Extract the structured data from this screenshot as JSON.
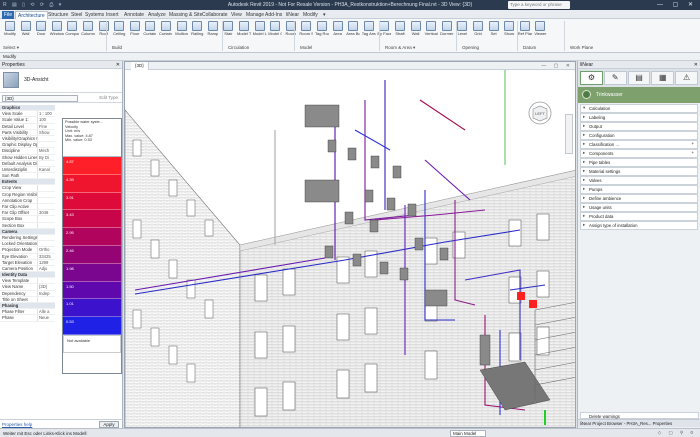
{
  "titlebar": {
    "title": "Autodesk Revit 2019 - Not For Resale Version - PH3A_Restkonstruktion+Berechnung Final.rvt - 3D View: {3D}",
    "search_placeholder": "Type a keyword or phrase",
    "quick_access": "R ▤ ▯ ⟲ ⟳ ⎙ ▾",
    "window_controls": "— ▢ ✕"
  },
  "tabs": [
    "File",
    "Architecture",
    "Structure",
    "Steel",
    "Systems",
    "Insert",
    "Annotate",
    "Analyze",
    "Massing & Site",
    "Collaborate",
    "View",
    "Manage",
    "Add-Ins",
    "liNear",
    "Modify",
    "▾"
  ],
  "active_tab": "Architecture",
  "ribbon": {
    "buttons": [
      "Modify",
      "Wall",
      "Door",
      "Window",
      "Component",
      "Column",
      "Roof",
      "Ceiling",
      "Floor",
      "Curtain System",
      "Curtain Grid",
      "Mullion",
      "Railing",
      "Ramp",
      "Stair",
      "Model Text",
      "Model Line",
      "Model Group",
      "Room",
      "Room Separator",
      "Tag Room",
      "Area",
      "Area Boundary",
      "Tag Area",
      "By Face",
      "Shaft",
      "Wall",
      "Vertical",
      "Dormer",
      "Level",
      "Grid",
      "Set",
      "Show",
      "Ref Plane",
      "Viewer"
    ],
    "panels": [
      "Select ▾",
      "Build",
      "Circulation",
      "Model",
      "Room & Area ▾",
      "Opening",
      "Datum",
      "Work Plane"
    ]
  },
  "options_bar": "Modify",
  "properties": {
    "header": "Properties",
    "type_name": "3D-Ansicht",
    "view_selector": "{3D}",
    "edit_type": "Edit Type",
    "rows": [
      {
        "k": "Graphics",
        "v": "",
        "group": true
      },
      {
        "k": "View Scale",
        "v": "1 : 100"
      },
      {
        "k": "Scale Value 1:",
        "v": "100"
      },
      {
        "k": "Detail Level",
        "v": "Fine"
      },
      {
        "k": "Parts Visibility",
        "v": "Show"
      },
      {
        "k": "Visibility/Graphics Overr...",
        "v": ""
      },
      {
        "k": "Graphic Display Options",
        "v": ""
      },
      {
        "k": "Discipline",
        "v": "Mech"
      },
      {
        "k": "Show Hidden Lines",
        "v": "By Di"
      },
      {
        "k": "Default Analysis Display S...",
        "v": ""
      },
      {
        "k": "Unterdisziplin",
        "v": "Kanal"
      },
      {
        "k": "Sun Path",
        "v": ""
      },
      {
        "k": "Extents",
        "v": "",
        "group": true
      },
      {
        "k": "Crop View",
        "v": ""
      },
      {
        "k": "Crop Region Visible",
        "v": ""
      },
      {
        "k": "Annotation Crop",
        "v": ""
      },
      {
        "k": "Far Clip Active",
        "v": ""
      },
      {
        "k": "Far Clip Offset",
        "v": "3048"
      },
      {
        "k": "Scope Box",
        "v": ""
      },
      {
        "k": "Section Box",
        "v": ""
      },
      {
        "k": "Camera",
        "v": "",
        "group": true
      },
      {
        "k": "Rendering Settings",
        "v": ""
      },
      {
        "k": "Locked Orientation",
        "v": ""
      },
      {
        "k": "Projection Mode",
        "v": "Ortho"
      },
      {
        "k": "Eye Elevation",
        "v": "33425"
      },
      {
        "k": "Target Elevation",
        "v": "1299"
      },
      {
        "k": "Camera Position",
        "v": "Adju"
      },
      {
        "k": "Identity Data",
        "v": "",
        "group": true
      },
      {
        "k": "View Template",
        "v": ""
      },
      {
        "k": "View Name",
        "v": "{3D}"
      },
      {
        "k": "Dependency",
        "v": "Indep"
      },
      {
        "k": "Title on Sheet",
        "v": ""
      },
      {
        "k": "Phasing",
        "v": "",
        "group": true
      },
      {
        "k": "Phase Filter",
        "v": "Alle a"
      },
      {
        "k": "Phase",
        "v": "Neue"
      }
    ],
    "help_link": "Properties help",
    "apply": "Apply"
  },
  "legend": {
    "caption": [
      "Possible water syste...",
      "Velocity",
      "Unit: m/s",
      "Max. value: 4.87",
      "Min. value: 0.53"
    ],
    "cells": [
      {
        "label": "4.87",
        "color": "#ff1f28"
      },
      {
        "label": "4.39",
        "color": "#f0152e"
      },
      {
        "label": "3.91",
        "color": "#dd0a3a"
      },
      {
        "label": "3.43",
        "color": "#c80548"
      },
      {
        "label": "2.95",
        "color": "#b0045d"
      },
      {
        "label": "2.46",
        "color": "#950474"
      },
      {
        "label": "1.98",
        "color": "#7a0690"
      },
      {
        "label": "1.50",
        "color": "#5f08ae"
      },
      {
        "label": "1.01",
        "color": "#3c12cc"
      },
      {
        "label": "0.53",
        "color": "#1f22e6"
      },
      {
        "label": "Not available",
        "color": "#ffffff"
      }
    ]
  },
  "view": {
    "tab": "{3D}",
    "controls": "— ▢ ✕",
    "cube_label": "LEFT"
  },
  "liNear": {
    "header": "liNear",
    "banner": "Trinkwasser",
    "items": [
      {
        "label": "Calculation",
        "open": true
      },
      {
        "label": "Labeling",
        "open": false
      },
      {
        "label": "Output",
        "open": false
      },
      {
        "label": "Configuration",
        "open": false
      },
      {
        "label": "Classification ...",
        "open": false,
        "more": "+"
      },
      {
        "label": "Components",
        "open": false,
        "more": "+"
      },
      {
        "label": "Pipe tables",
        "open": false
      },
      {
        "label": "Material settings",
        "open": false
      },
      {
        "label": "Valves",
        "open": false
      },
      {
        "label": "Pumps",
        "open": false
      },
      {
        "label": "Define ambience",
        "open": false
      },
      {
        "label": "Usage units",
        "open": false
      },
      {
        "label": "Product data",
        "open": false
      },
      {
        "label": "Assign type of installation",
        "open": false
      }
    ],
    "delete_warnings": "Delete warnings",
    "bottom_tabs": "liNear   Project Browser - PH3A_Res...   Properties"
  },
  "status": {
    "message": "Weiter mit Esc oder Links-Klick ins Modell",
    "model": "Main Model",
    "icons": "◇ ▢ ⚲ 0"
  }
}
